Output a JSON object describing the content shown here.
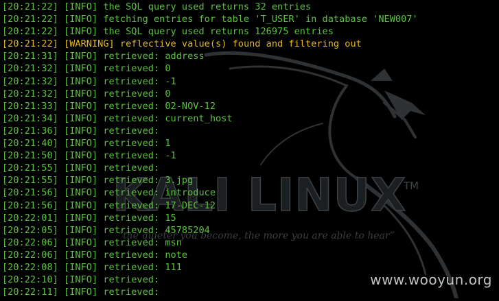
{
  "watermark": {
    "logo_text": "KALI LINUX",
    "trademark": "TM",
    "tagline": "“the quieter you become, the more you are able to hear”",
    "site": "www.wooyun.org"
  },
  "colors": {
    "info": "#5bc23f",
    "warning": "#e3b722",
    "background": "#000000"
  },
  "log": [
    {
      "time": "[20:21:22]",
      "level": "[INFO]",
      "message": "the SQL query used returns 32 entries"
    },
    {
      "time": "[20:21:22]",
      "level": "[INFO]",
      "message": "fetching entries for table 'T_USER' in database 'NEW007'"
    },
    {
      "time": "[20:21:22]",
      "level": "[INFO]",
      "message": "the SQL query used returns 126975 entries"
    },
    {
      "time": "[20:21:22]",
      "level": "[WARNING]",
      "message": "reflective value(s) found and filtering out"
    },
    {
      "time": "[20:21:31]",
      "level": "[INFO]",
      "message": "retrieved: address"
    },
    {
      "time": "[20:21:32]",
      "level": "[INFO]",
      "message": "retrieved: 0"
    },
    {
      "time": "[20:21:32]",
      "level": "[INFO]",
      "message": "retrieved: -1"
    },
    {
      "time": "[20:21:32]",
      "level": "[INFO]",
      "message": "retrieved: 0"
    },
    {
      "time": "[20:21:33]",
      "level": "[INFO]",
      "message": "retrieved: 02-NOV-12"
    },
    {
      "time": "[20:21:34]",
      "level": "[INFO]",
      "message": "retrieved: current_host"
    },
    {
      "time": "[20:21:36]",
      "level": "[INFO]",
      "message": "retrieved:"
    },
    {
      "time": "[20:21:40]",
      "level": "[INFO]",
      "message": "retrieved: 1"
    },
    {
      "time": "[20:21:50]",
      "level": "[INFO]",
      "message": "retrieved: -1"
    },
    {
      "time": "[20:21:55]",
      "level": "[INFO]",
      "message": "retrieved:"
    },
    {
      "time": "[20:21:55]",
      "level": "[INFO]",
      "message": "retrieved: 3.jpg"
    },
    {
      "time": "[20:21:56]",
      "level": "[INFO]",
      "message": "retrieved: introduce"
    },
    {
      "time": "[20:21:56]",
      "level": "[INFO]",
      "message": "retrieved: 17-DEC-12"
    },
    {
      "time": "[20:22:01]",
      "level": "[INFO]",
      "message": "retrieved: 15"
    },
    {
      "time": "[20:22:05]",
      "level": "[INFO]",
      "message": "retrieved: 45785204"
    },
    {
      "time": "[20:22:06]",
      "level": "[INFO]",
      "message": "retrieved: msn"
    },
    {
      "time": "[20:22:06]",
      "level": "[INFO]",
      "message": "retrieved: note"
    },
    {
      "time": "[20:22:08]",
      "level": "[INFO]",
      "message": "retrieved: 111"
    },
    {
      "time": "[20:22:10]",
      "level": "[INFO]",
      "message": "retrieved:"
    },
    {
      "time": "[20:22:11]",
      "level": "[INFO]",
      "message": "retrieved:"
    }
  ]
}
